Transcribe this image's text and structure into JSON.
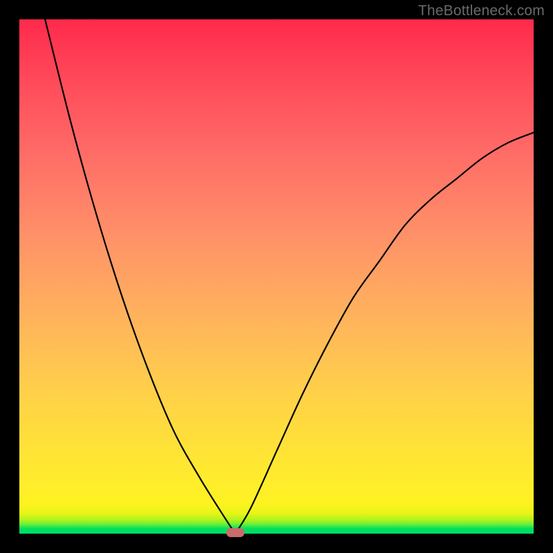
{
  "watermark": "TheBottleneck.com",
  "chart_data": {
    "type": "line",
    "title": "",
    "xlabel": "",
    "ylabel": "",
    "xlim": [
      0,
      100
    ],
    "ylim": [
      0,
      100
    ],
    "minimum_x": 42,
    "left_branch": {
      "x": [
        5,
        10,
        15,
        20,
        25,
        30,
        35,
        40,
        42
      ],
      "y": [
        100,
        80,
        62,
        46,
        32,
        20,
        11,
        3,
        0
      ]
    },
    "right_branch": {
      "x": [
        42,
        45,
        50,
        55,
        60,
        65,
        70,
        75,
        80,
        85,
        90,
        95,
        100
      ],
      "y": [
        0,
        5,
        16,
        27,
        37,
        46,
        53,
        60,
        65,
        69,
        73,
        76,
        78
      ]
    },
    "marker": {
      "x": 42,
      "y": 0,
      "color": "#c96b6b"
    },
    "gradient_bands_from_bottom": [
      "#00e060",
      "#35e84e",
      "#6aee3a",
      "#a0f227",
      "#d6f41a",
      "#f6f21a",
      "#ffee2a",
      "#ffe438",
      "#ffd946",
      "#ffce52",
      "#ffc25c",
      "#ffb664",
      "#ffa96a",
      "#ff9b6e",
      "#ff8d70",
      "#ff7e6f",
      "#ff6f6c",
      "#ff6066",
      "#ff505e",
      "#ff3f55",
      "#ff2e4c",
      "#ff1e45"
    ]
  }
}
